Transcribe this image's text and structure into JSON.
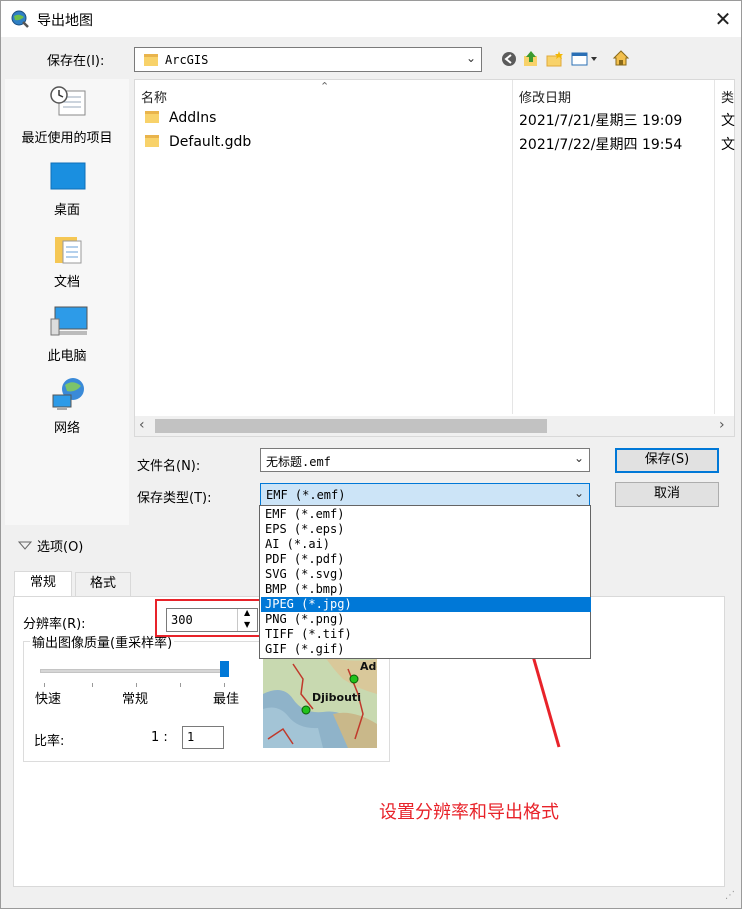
{
  "window": {
    "title": "导出地图",
    "close_glyph": "✕"
  },
  "savein": {
    "label": "保存在(I):",
    "value": "ArcGIS"
  },
  "places": [
    {
      "label": "最近使用的项目",
      "icon": "recent-places-icon"
    },
    {
      "label": "桌面",
      "icon": "desktop-icon"
    },
    {
      "label": "文档",
      "icon": "documents-icon"
    },
    {
      "label": "此电脑",
      "icon": "this-pc-icon"
    },
    {
      "label": "网络",
      "icon": "network-icon"
    }
  ],
  "filelist": {
    "columns": [
      "名称",
      "修改日期",
      "类"
    ],
    "rows": [
      {
        "name": "AddIns",
        "date": "2021/7/21/星期三 19:09",
        "type": "文"
      },
      {
        "name": "Default.gdb",
        "date": "2021/7/22/星期四 19:54",
        "type": "文"
      }
    ]
  },
  "filename": {
    "label": "文件名(N):",
    "value": "无标题.emf"
  },
  "filetype": {
    "label": "保存类型(T):",
    "value": "EMF (*.emf)",
    "options": [
      "EMF (*.emf)",
      "EPS (*.eps)",
      "AI (*.ai)",
      "PDF (*.pdf)",
      "SVG (*.svg)",
      "BMP (*.bmp)",
      "JPEG (*.jpg)",
      "PNG (*.png)",
      "TIFF (*.tif)",
      "GIF (*.gif)"
    ],
    "highlighted": "JPEG (*.jpg)"
  },
  "buttons": {
    "save": "保存(S)",
    "cancel": "取消"
  },
  "options": {
    "label": "选项(O)",
    "tabs": [
      "常规",
      "格式"
    ],
    "resolution_label": "分辨率(R):",
    "resolution_value": "300",
    "quality_group": "输出图像质量(重采样率)",
    "slider_labels": [
      "快速",
      "常规",
      "最佳"
    ],
    "slider_level": 1.0,
    "ratio_label": "比率:",
    "ratio_prefix": "1 :",
    "ratio_value": "1",
    "preview_labels": [
      "Djibouti",
      "Add"
    ]
  },
  "annotation": "设置分辨率和导出格式",
  "colors": {
    "accent": "#0078d7",
    "annotation_red": "#e8232a"
  }
}
